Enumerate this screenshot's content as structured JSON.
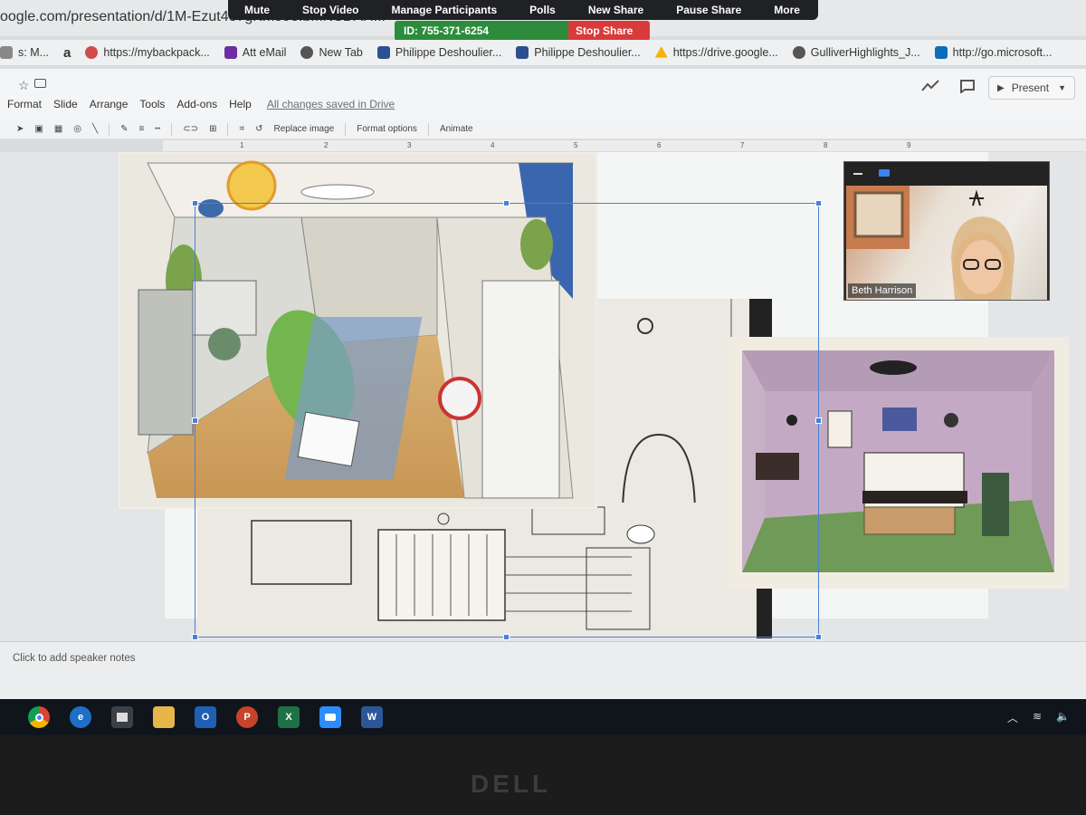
{
  "browser": {
    "url": "oogle.com/presentation/d/1M-Ezut4e7gKm59oIbMNSDAH..."
  },
  "zoom": {
    "buttons": [
      "Mute",
      "Stop Video",
      "Manage Participants",
      "Polls",
      "New Share",
      "Pause Share",
      "More"
    ],
    "meeting_id": "ID: 755-371-6254",
    "stop_share": "Stop Share"
  },
  "bookmarks": [
    {
      "label": "s: M...",
      "icon": "apps-icon",
      "color": "#888888"
    },
    {
      "label": "a",
      "icon": "amazon-icon",
      "color": "#222222"
    },
    {
      "label": "https://mybackpack...",
      "icon": "backpack-icon",
      "color": "#d24a4a"
    },
    {
      "label": "Att eMail",
      "icon": "yahoo-icon",
      "color": "#6b2fa3"
    },
    {
      "label": "New Tab",
      "icon": "globe-icon",
      "color": "#555555"
    },
    {
      "label": "Philippe Deshoulier...",
      "icon": "fd-icon",
      "color": "#2c4f8f"
    },
    {
      "label": "Philippe Deshoulier...",
      "icon": "fd-icon",
      "color": "#2c4f8f"
    },
    {
      "label": "https://drive.google...",
      "icon": "drive-icon",
      "color": "#f4b400"
    },
    {
      "label": "GulliverHighlights_J...",
      "icon": "globe-icon",
      "color": "#555555"
    },
    {
      "label": "http://go.microsoft...",
      "icon": "bing-icon",
      "color": "#0f6cbd"
    }
  ],
  "docs": {
    "menus": [
      "Format",
      "Slide",
      "Arrange",
      "Tools",
      "Add-ons",
      "Help"
    ],
    "saved_status": "All changes saved in Drive",
    "present_label": "Present"
  },
  "toolbar": {
    "replace_image": "Replace image",
    "format_options": "Format options",
    "animate": "Animate"
  },
  "ruler": [
    "1",
    "2",
    "3",
    "4",
    "5",
    "6",
    "7",
    "8",
    "9"
  ],
  "notes": {
    "placeholder": "Click to add speaker notes"
  },
  "video": {
    "participant_name": "Beth Harrison"
  },
  "taskbar": {
    "apps": [
      {
        "name": "chrome",
        "label": "",
        "color": "#e0a03a"
      },
      {
        "name": "edge",
        "label": "e",
        "color": "#1f6fc9"
      },
      {
        "name": "store",
        "label": "",
        "color": "#3b3f46"
      },
      {
        "name": "file-explorer",
        "label": "",
        "color": "#e7b54a"
      },
      {
        "name": "outlook",
        "label": "O",
        "color": "#1f5fb4"
      },
      {
        "name": "powerpoint",
        "label": "P",
        "color": "#c9432b"
      },
      {
        "name": "excel",
        "label": "X",
        "color": "#1e7145"
      },
      {
        "name": "zoom",
        "label": "",
        "color": "#2d8cff"
      },
      {
        "name": "word",
        "label": "W",
        "color": "#2b579a"
      }
    ]
  },
  "hardware": {
    "brand": "DELL"
  }
}
